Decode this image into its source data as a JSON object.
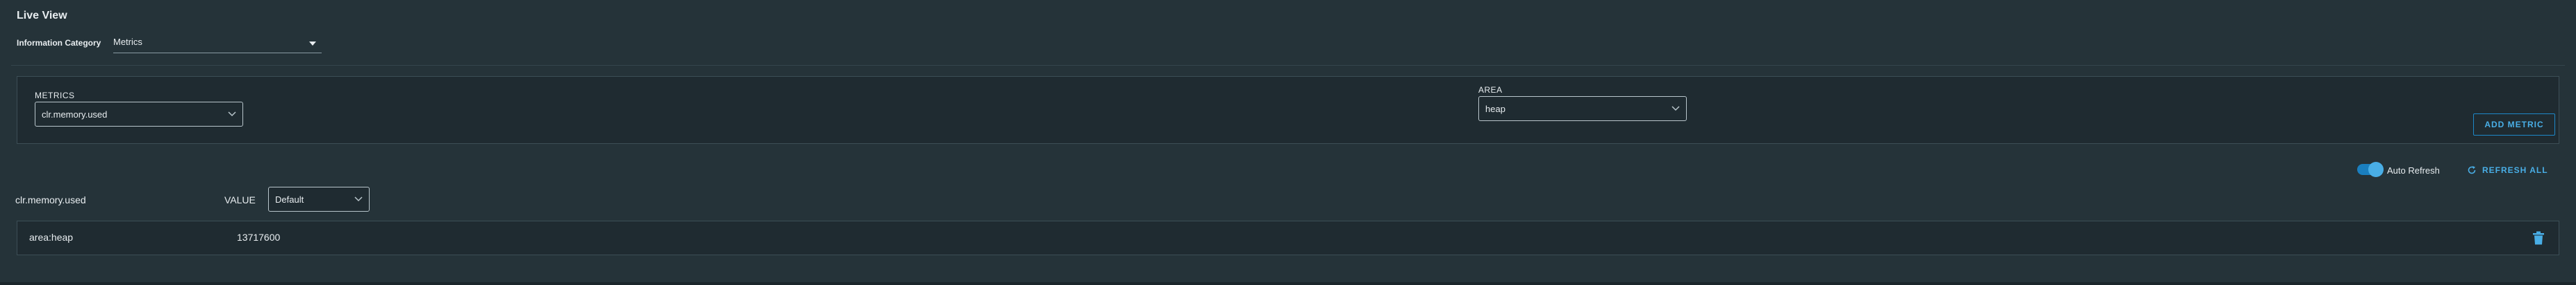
{
  "live_view": {
    "title": "Live View",
    "category_label": "Information Category",
    "category_value": "Metrics"
  },
  "metrics_panel": {
    "metrics_label": "METRICS",
    "metrics_value": "clr.memory.used",
    "area_label": "AREA",
    "area_value": "heap",
    "add_metric_label": "ADD METRIC"
  },
  "controls": {
    "auto_refresh_label": "Auto Refresh",
    "auto_refresh_on": true,
    "refresh_all_label": "REFRESH ALL"
  },
  "metric_section": {
    "metric_name": "clr.memory.used",
    "value_label": "VALUE",
    "value_select": "Default",
    "rows": [
      {
        "tag": "area:heap",
        "value": "13717600"
      }
    ]
  },
  "colors": {
    "background": "#253339",
    "panel": "#1f2b31",
    "accent": "#49aee6"
  }
}
